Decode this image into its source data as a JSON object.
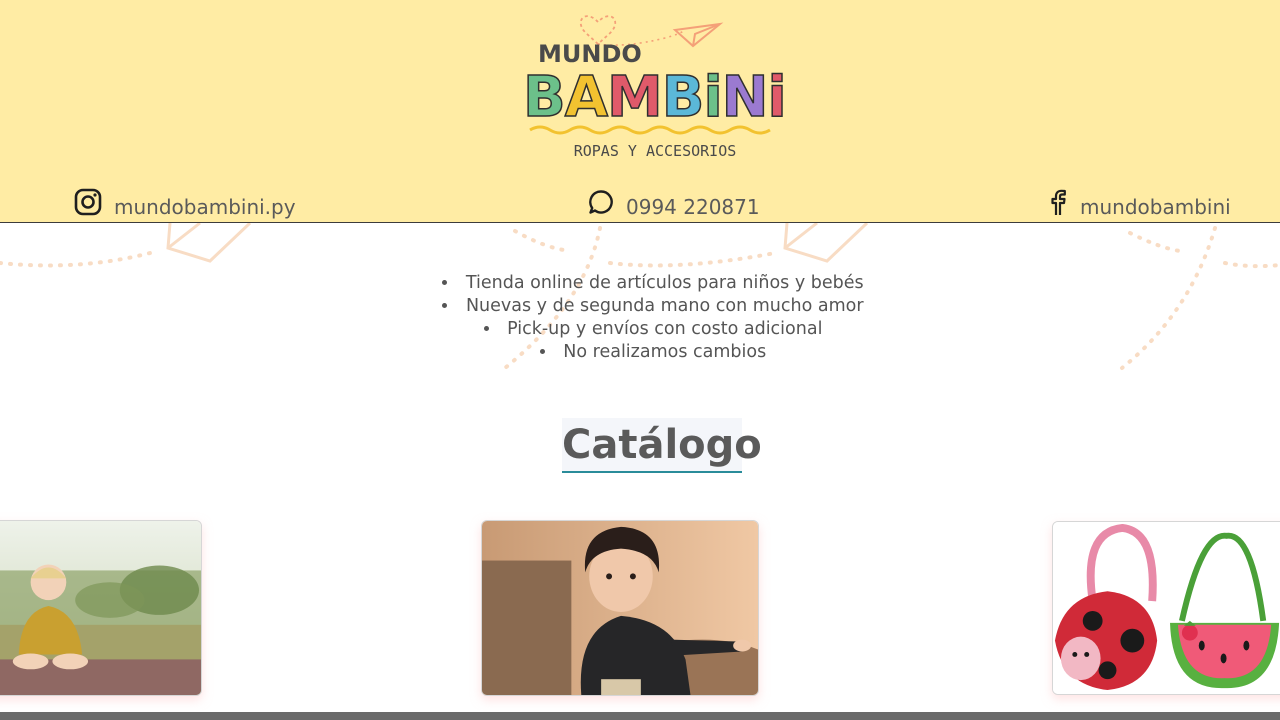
{
  "brand": {
    "top_word": "MUNDO",
    "main_word": "BAMBiNi",
    "tagline": "ROPAS Y ACCESORIOS"
  },
  "contacts": {
    "instagram": {
      "icon": "instagram-icon",
      "text": "mundobambini.py"
    },
    "whatsapp": {
      "icon": "whatsapp-icon",
      "text": "0994 220871"
    },
    "facebook": {
      "icon": "facebook-icon",
      "text": "mundobambini"
    }
  },
  "info": {
    "items": [
      "Tienda online de artículos para niños y bebés",
      "Nuevas y de segunda mano con mucho amor",
      "Pick-up y envíos con costo adicional",
      "No realizamos cambios"
    ]
  },
  "catalog": {
    "title": "Catálogo"
  },
  "colors": {
    "header_bg": "#ffeca4",
    "accent_underline": "#2a8c9a",
    "text": "#5a5a5a"
  }
}
